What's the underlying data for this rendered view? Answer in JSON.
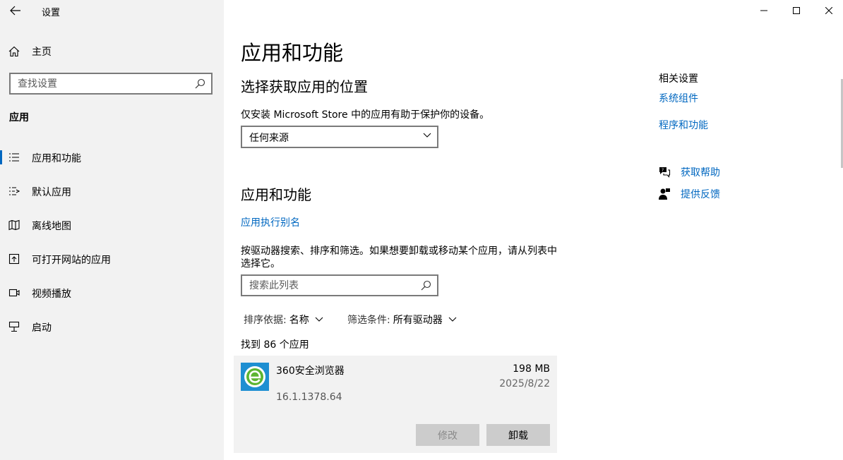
{
  "window": {
    "title": "设置"
  },
  "sidebar": {
    "home_label": "主页",
    "search_placeholder": "查找设置",
    "section_title": "应用",
    "items": [
      {
        "label": "应用和功能",
        "icon": "list-icon",
        "active": true
      },
      {
        "label": "默认应用",
        "icon": "default-apps-icon"
      },
      {
        "label": "离线地图",
        "icon": "map-icon"
      },
      {
        "label": "可打开网站的应用",
        "icon": "open-website-icon"
      },
      {
        "label": "视频播放",
        "icon": "video-icon"
      },
      {
        "label": "启动",
        "icon": "startup-icon"
      }
    ]
  },
  "main": {
    "page_title": "应用和功能",
    "install_section": {
      "title": "选择获取应用的位置",
      "description": "仅安装 Microsoft Store 中的应用有助于保护你的设备。",
      "source_select_value": "任何来源"
    },
    "apps_section": {
      "title": "应用和功能",
      "alias_link": "应用执行别名",
      "description_line1": "按驱动器搜索、排序和筛选。如果想要卸载或移动某个应用，请从列表中",
      "description_line2": "选择它。",
      "search_placeholder": "搜索此列表",
      "sort_label": "排序依据:",
      "sort_value": "名称",
      "filter_label": "筛选条件:",
      "filter_value": "所有驱动器",
      "found_count": "找到 86 个应用"
    },
    "app_item": {
      "name": "360安全浏览器",
      "size": "198 MB",
      "date": "2025/8/22",
      "version": "16.1.1378.64",
      "modify_label": "修改",
      "uninstall_label": "卸载",
      "icon": "360-browser-icon",
      "icon_color": "#1e8fd2"
    }
  },
  "related": {
    "title": "相关设置",
    "links": [
      "系统组件",
      "程序和功能"
    ],
    "help_link": "获取帮助",
    "feedback_link": "提供反馈"
  },
  "colors": {
    "accent": "#0067c0",
    "sidebar_bg": "#f2f2f2",
    "card_bg": "#f2f2f2"
  }
}
